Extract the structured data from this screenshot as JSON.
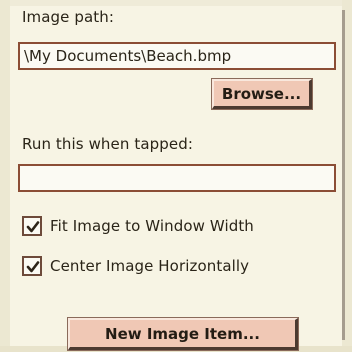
{
  "image_path": {
    "label": "Image path:",
    "value": "\\My Documents\\Beach.bmp"
  },
  "browse_button": {
    "label": "Browse..."
  },
  "run_when_tapped": {
    "label": "Run this when tapped:",
    "value": ""
  },
  "options": [
    {
      "label": "Fit Image to Window Width",
      "checked": true
    },
    {
      "label": "Center Image Horizontally",
      "checked": true
    }
  ],
  "new_item_button": {
    "label": "New Image Item..."
  },
  "colors": {
    "panel_background": "#f7f4e4",
    "field_border": "#8b4d35",
    "button_face": "#f0c8b5",
    "text": "#2a2418"
  }
}
